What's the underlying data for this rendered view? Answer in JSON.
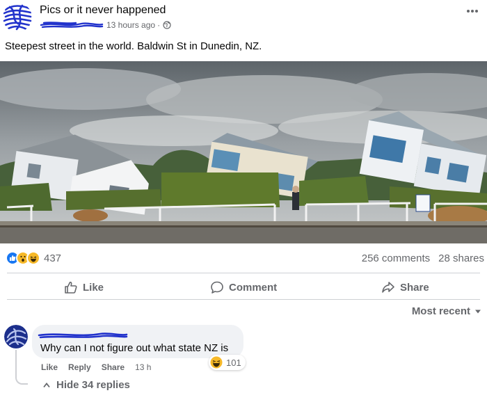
{
  "post": {
    "page_name": "Pics or it never happened",
    "time": "13 hours ago",
    "separator": "·",
    "text": "Steepest street in the world. Baldwin St in Dunedin, NZ.",
    "more_icon": "more-dots-icon"
  },
  "stats": {
    "reaction_count": "437",
    "comments": "256 comments",
    "shares": "28 shares"
  },
  "actions": {
    "like": "Like",
    "comment": "Comment",
    "share": "Share"
  },
  "sort": {
    "label": "Most recent"
  },
  "comment": {
    "text": "Why can I not figure out what state NZ is",
    "reaction_count": "101",
    "like": "Like",
    "reply": "Reply",
    "share": "Share",
    "time": "13 h"
  },
  "replies": {
    "toggle_label": "Hide 34 replies"
  },
  "colors": {
    "scribble": "#2233cc",
    "secondary_text": "#65676b",
    "like_blue": "#1877f2",
    "haha_yellow": "#f7b928",
    "bubble_bg": "#f0f2f5"
  }
}
